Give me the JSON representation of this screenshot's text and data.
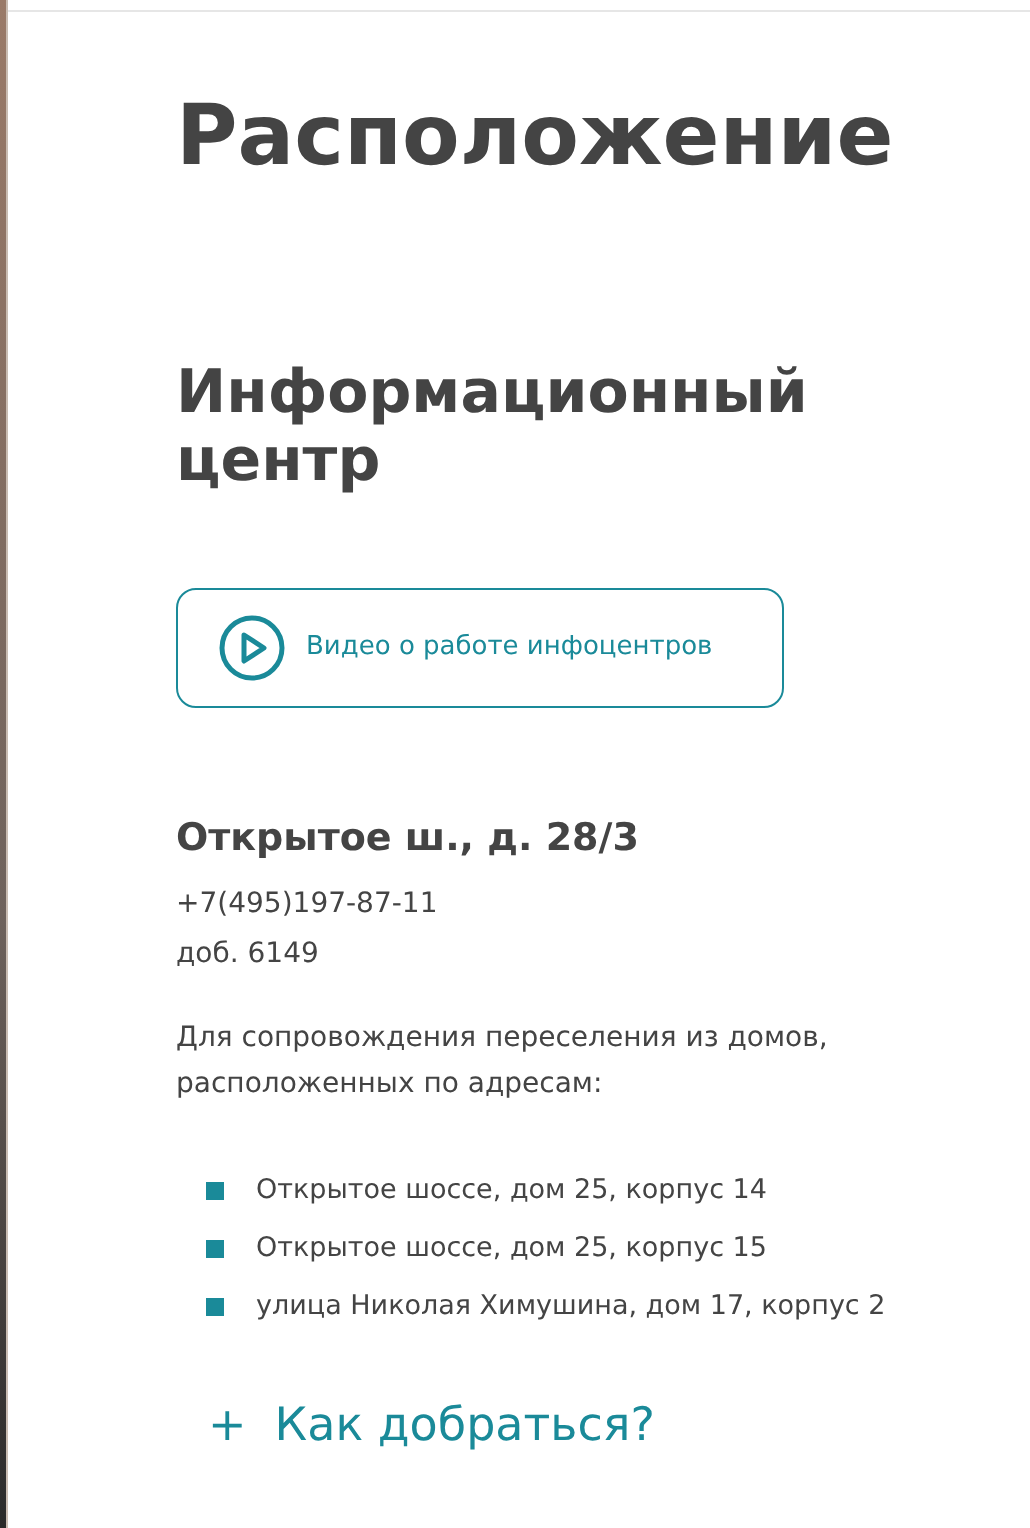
{
  "title": "Расположение",
  "center": {
    "heading": "Информационный центр",
    "video_button": "Видео о работе инфоцентров",
    "address": "Открытое ш., д. 28/3",
    "phone": "+7(495)197-87-11",
    "extension": "доб. 6149",
    "description": "Для сопровождения переселения из домов, расположенных по адресам:",
    "addresses": [
      "Открытое шоссе, дом 25, корпус 14",
      "Открытое шоссе, дом 25, корпус 15",
      "улица Николая Химушина, дом 17, корпус 2"
    ],
    "directions": {
      "icon": "+",
      "label": "Как добраться?",
      "expanded": false
    }
  }
}
